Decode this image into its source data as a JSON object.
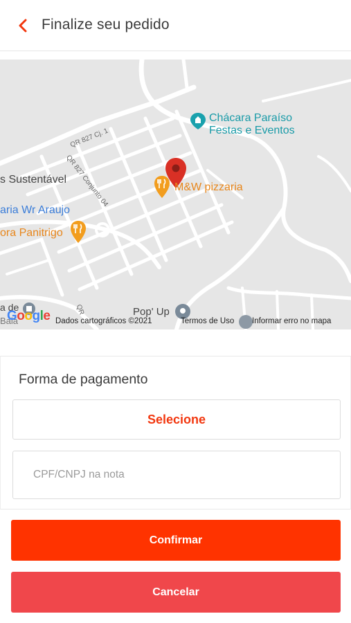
{
  "header": {
    "title": "Finalize seu pedido",
    "back_icon": "chevron-left-icon"
  },
  "colors": {
    "accent": "#ff3300",
    "cancel": "#f0474b",
    "selecione": "#f2370f"
  },
  "map": {
    "places": {
      "chacara_line1": "Chácara Paraíso",
      "chacara_line2": "Festas e Eventos",
      "pizzaria": "M&W pizzaria",
      "sustentavel": "s Sustentável",
      "araujo": "aria Wr Araujo",
      "panitrigo": "ora Panitrigo",
      "popup": "Pop' Up",
      "left_cut": "a de",
      "left_cut2": "Bala"
    },
    "roads": {
      "qr827cj1": "QR 827 Cj. 1",
      "qr827conj04": "QR 827 Conjunto 04",
      "qr": "QR"
    },
    "attribution": {
      "google": "Google",
      "data": "Dados cartográficos ©2021",
      "terms": "Termos de Uso",
      "report": "Informar erro no mapa"
    }
  },
  "payment": {
    "title": "Forma de pagamento",
    "select_label": "Selecione",
    "cpf_placeholder": "CPF/CNPJ na nota",
    "cpf_value": ""
  },
  "actions": {
    "confirm": "Confirmar",
    "cancel": "Cancelar"
  }
}
